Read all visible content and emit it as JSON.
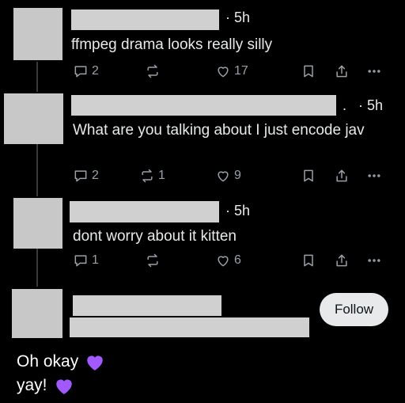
{
  "posts": [
    {
      "time": "· 5h",
      "text": "ffmpeg drama looks really silly",
      "replies": "2",
      "reposts": "",
      "likes": "17"
    },
    {
      "time": "· 5h",
      "text": "What are you talking about I just encode jav",
      "replies": "2",
      "reposts": "1",
      "likes": "9"
    },
    {
      "time": "· 5h",
      "text": "dont worry about it kitten",
      "replies": "1",
      "reposts": "",
      "likes": "6"
    }
  ],
  "post2_dot": ".",
  "suggestion": {
    "follow_label": "Follow"
  },
  "caption": {
    "line1": "Oh okay",
    "line2": "yay!",
    "emoji_color": "#a259ff"
  },
  "icons": [
    "reply-icon",
    "repost-icon",
    "like-icon",
    "bookmark-icon",
    "share-icon",
    "more-icon"
  ],
  "colors": {
    "background": "#000000",
    "text": "#e7e9ea",
    "icon": "#9aa0a6",
    "heart": "#a259ff"
  }
}
